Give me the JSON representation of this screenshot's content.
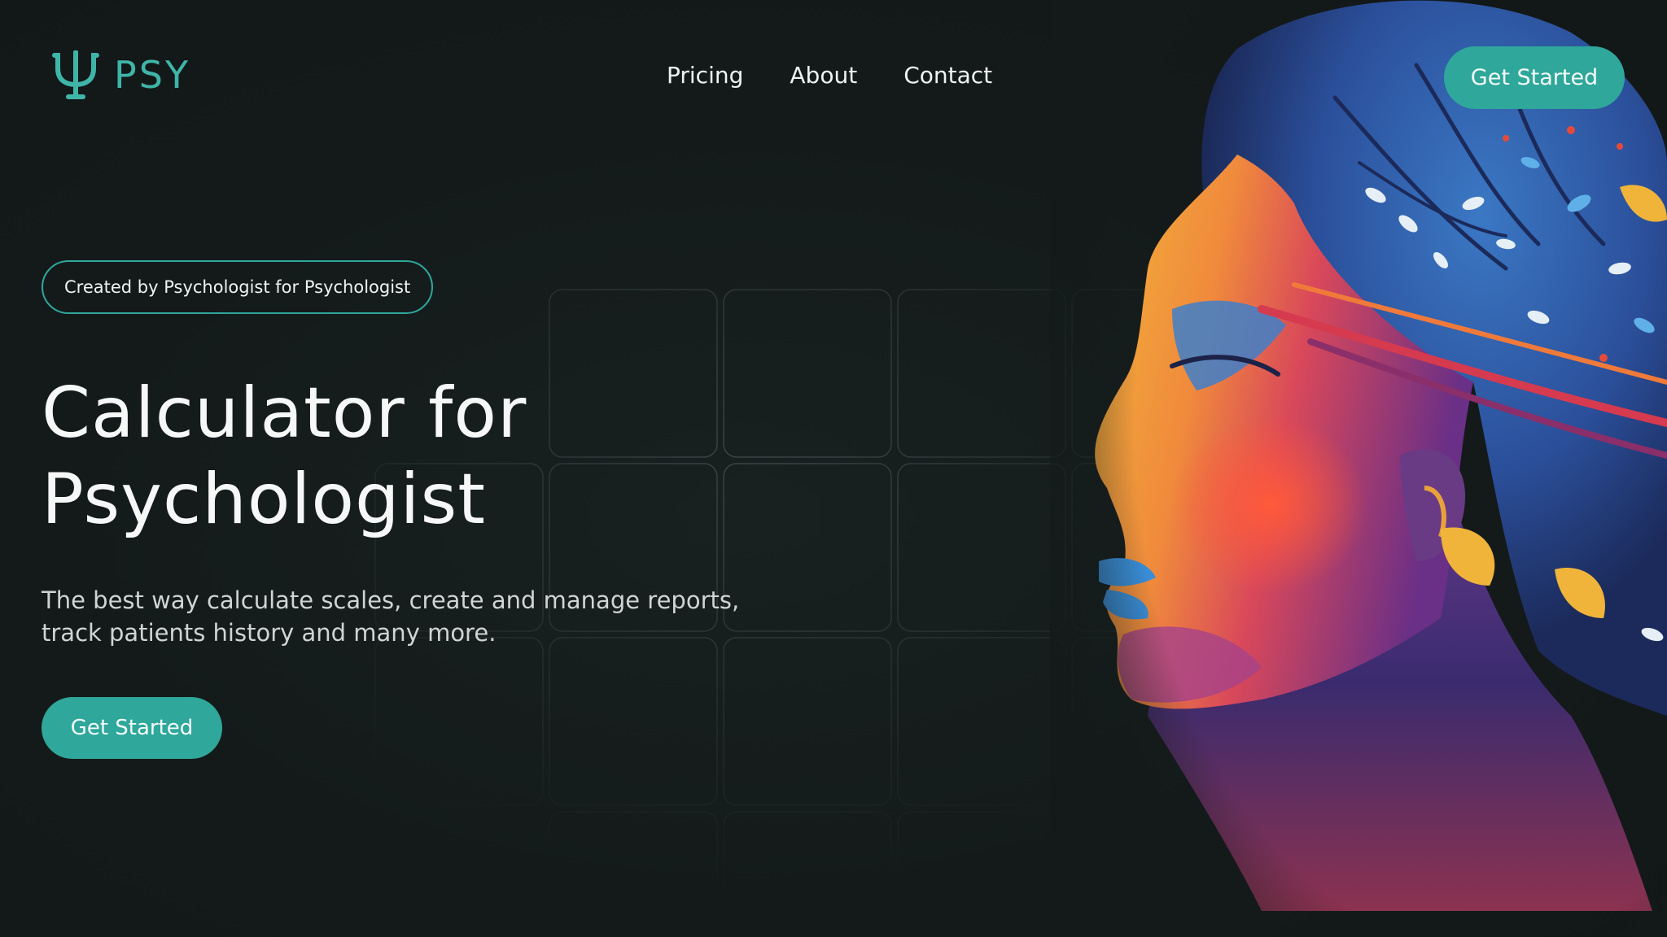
{
  "brand": {
    "logo_symbol": "Ψ",
    "name": "PSY",
    "accent_color": "#2fa79b"
  },
  "nav": {
    "items": [
      {
        "label": "Pricing"
      },
      {
        "label": "About"
      },
      {
        "label": "Contact"
      }
    ]
  },
  "header": {
    "cta_label": "Get Started"
  },
  "hero": {
    "badge": "Created by Psychologist for Psychologist",
    "title_line1": "Calculator for",
    "title_line2": "Psychologist",
    "subtitle_line1": "The best way calculate scales, create and manage reports,",
    "subtitle_line2": "track patients history and many more.",
    "cta_label": "Get Started"
  },
  "illustration": {
    "icon": "colorful-face-profile-illustration"
  }
}
